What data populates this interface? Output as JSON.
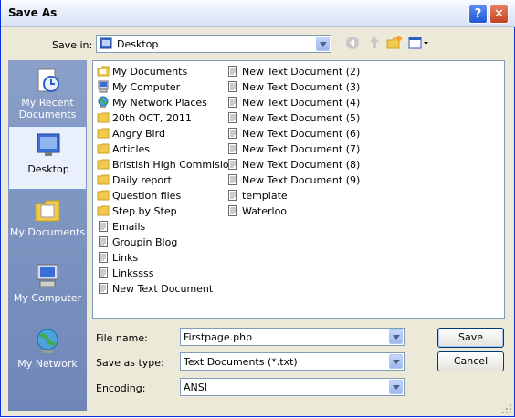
{
  "window": {
    "title": "Save As"
  },
  "titlebar": {
    "help_icon": "?",
    "close_icon": "✕"
  },
  "savein": {
    "label": "Save in:",
    "value": "Desktop"
  },
  "places": [
    {
      "label": "My Recent Documents",
      "icon": "recent-documents-icon"
    },
    {
      "label": "Desktop",
      "icon": "desktop-icon"
    },
    {
      "label": "My Documents",
      "icon": "my-documents-icon"
    },
    {
      "label": "My Computer",
      "icon": "my-computer-icon"
    },
    {
      "label": "My Network",
      "icon": "my-network-icon"
    }
  ],
  "files_col1": [
    {
      "name": "My Documents",
      "icon": "my-documents-icon"
    },
    {
      "name": "My Computer",
      "icon": "my-computer-icon"
    },
    {
      "name": "My Network Places",
      "icon": "network-places-icon"
    },
    {
      "name": "20th OCT, 2011",
      "icon": "folder-icon"
    },
    {
      "name": "Angry Bird",
      "icon": "folder-icon"
    },
    {
      "name": "Articles",
      "icon": "folder-icon"
    },
    {
      "name": "Bristish High Commision",
      "icon": "folder-icon"
    },
    {
      "name": "Daily report",
      "icon": "folder-icon"
    },
    {
      "name": "Question files",
      "icon": "folder-icon"
    },
    {
      "name": "Step by Step",
      "icon": "folder-icon"
    },
    {
      "name": "Emails",
      "icon": "text-file-icon"
    },
    {
      "name": "Groupin Blog",
      "icon": "text-file-icon"
    },
    {
      "name": "Links",
      "icon": "text-file-icon"
    },
    {
      "name": "Linkssss",
      "icon": "text-file-icon"
    },
    {
      "name": "New Text Document",
      "icon": "text-file-icon"
    }
  ],
  "files_col2": [
    {
      "name": "New Text Document (2)",
      "icon": "text-file-icon"
    },
    {
      "name": "New Text Document (3)",
      "icon": "text-file-icon"
    },
    {
      "name": "New Text Document (4)",
      "icon": "text-file-icon"
    },
    {
      "name": "New Text Document (5)",
      "icon": "text-file-icon"
    },
    {
      "name": "New Text Document (6)",
      "icon": "text-file-icon"
    },
    {
      "name": "New Text Document (7)",
      "icon": "text-file-icon"
    },
    {
      "name": "New Text Document (8)",
      "icon": "text-file-icon"
    },
    {
      "name": "New Text Document (9)",
      "icon": "text-file-icon"
    },
    {
      "name": "template",
      "icon": "text-file-icon"
    },
    {
      "name": "Waterloo",
      "icon": "text-file-icon"
    }
  ],
  "filename": {
    "label": "File name:",
    "value": "Firstpage.php"
  },
  "saveastype": {
    "label": "Save as type:",
    "value": "Text Documents (*.txt)"
  },
  "encoding": {
    "label": "Encoding:",
    "value": "ANSI"
  },
  "buttons": {
    "save": "Save",
    "cancel": "Cancel"
  },
  "colors": {
    "title_bar": "#e7eefb",
    "dialog_bg": "#ece9d8",
    "places_bar": "#7a8fbf",
    "folder": "#f2c94c"
  }
}
